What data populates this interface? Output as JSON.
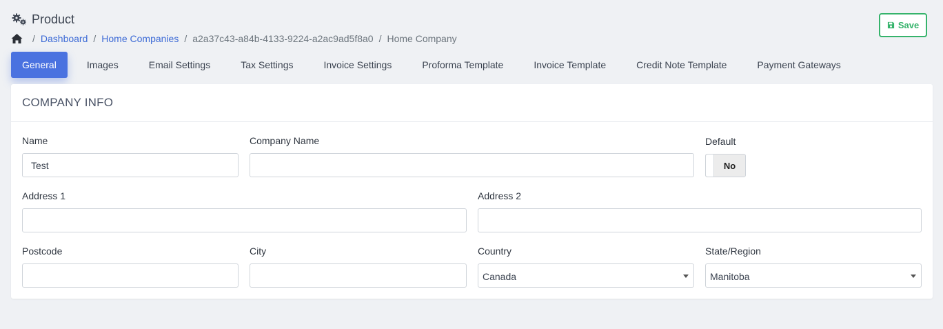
{
  "header": {
    "title": "Product",
    "icon": "gears-icon"
  },
  "breadcrumb": {
    "home_icon": "home-icon",
    "items": [
      "Dashboard",
      "Home Companies",
      "a2a37c43-a84b-4133-9224-a2ac9ad5f8a0",
      "Home Company"
    ],
    "separator": "/"
  },
  "toolbar": {
    "save_label": "Save",
    "save_icon": "floppy-disk-icon",
    "accent": "#35b36b"
  },
  "tabs": [
    {
      "label": "General",
      "active": true
    },
    {
      "label": "Images"
    },
    {
      "label": "Email Settings"
    },
    {
      "label": "Tax Settings"
    },
    {
      "label": "Invoice Settings"
    },
    {
      "label": "Proforma Template"
    },
    {
      "label": "Invoice Template"
    },
    {
      "label": "Credit Note Template"
    },
    {
      "label": "Payment Gateways"
    }
  ],
  "active_tab_color": "#4a72e0",
  "card": {
    "title": "COMPANY INFO",
    "fields": {
      "name": {
        "label": "Name",
        "value": "Test"
      },
      "company_name": {
        "label": "Company Name",
        "value": ""
      },
      "default": {
        "label": "Default",
        "value": "No"
      },
      "address1": {
        "label": "Address 1",
        "value": ""
      },
      "address2": {
        "label": "Address 2",
        "value": ""
      },
      "postcode": {
        "label": "Postcode",
        "value": ""
      },
      "city": {
        "label": "City",
        "value": ""
      },
      "country": {
        "label": "Country",
        "value": "Canada"
      },
      "state": {
        "label": "State/Region",
        "value": "Manitoba"
      }
    }
  }
}
